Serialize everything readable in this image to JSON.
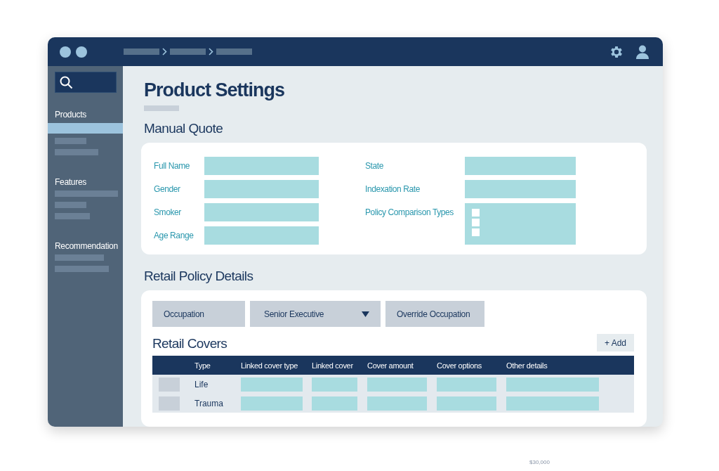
{
  "sidebar": {
    "sections": [
      {
        "label": "Products",
        "items": [
          {
            "selected": true
          },
          {
            "selected": false
          },
          {
            "selected": false
          }
        ]
      },
      {
        "label": "Features",
        "items": [
          {
            "selected": false
          },
          {
            "selected": false
          },
          {
            "selected": false
          }
        ]
      },
      {
        "label": "Recommendation",
        "items": [
          {
            "selected": false
          },
          {
            "selected": false
          }
        ]
      }
    ]
  },
  "page_title": "Product Settings",
  "manual_quote": {
    "title": "Manual Quote",
    "columns": [
      [
        {
          "label": "Full Name",
          "kind": "text"
        },
        {
          "label": "Gender",
          "kind": "text"
        },
        {
          "label": "Smoker",
          "kind": "text"
        },
        {
          "label": "Age Range",
          "kind": "text"
        }
      ],
      [
        {
          "label": "State",
          "kind": "text"
        },
        {
          "label": "Indexation Rate",
          "kind": "text"
        },
        {
          "label": "Policy Comparison Types",
          "kind": "checklist",
          "options": [
            {
              "checked": false
            },
            {
              "checked": false
            },
            {
              "checked": false
            }
          ]
        }
      ]
    ]
  },
  "retail_policy": {
    "title": "Retail Policy Details",
    "occupation": [
      {
        "kind": "label",
        "text": "Occupation"
      },
      {
        "kind": "dropdown",
        "value": "Senior Executive"
      },
      {
        "kind": "button",
        "text": "Override Occupation"
      }
    ],
    "covers_title": "Retail Covers",
    "add_button": "+ Add",
    "table": {
      "columns": [
        "Type",
        "Linked cover type",
        "Linked cover",
        "Cover amount",
        "Cover options",
        "Other details"
      ],
      "rows": [
        {
          "type": "Life",
          "checked": false
        },
        {
          "type": "Trauma",
          "checked": false
        }
      ]
    }
  },
  "footer_note": "$30,000"
}
